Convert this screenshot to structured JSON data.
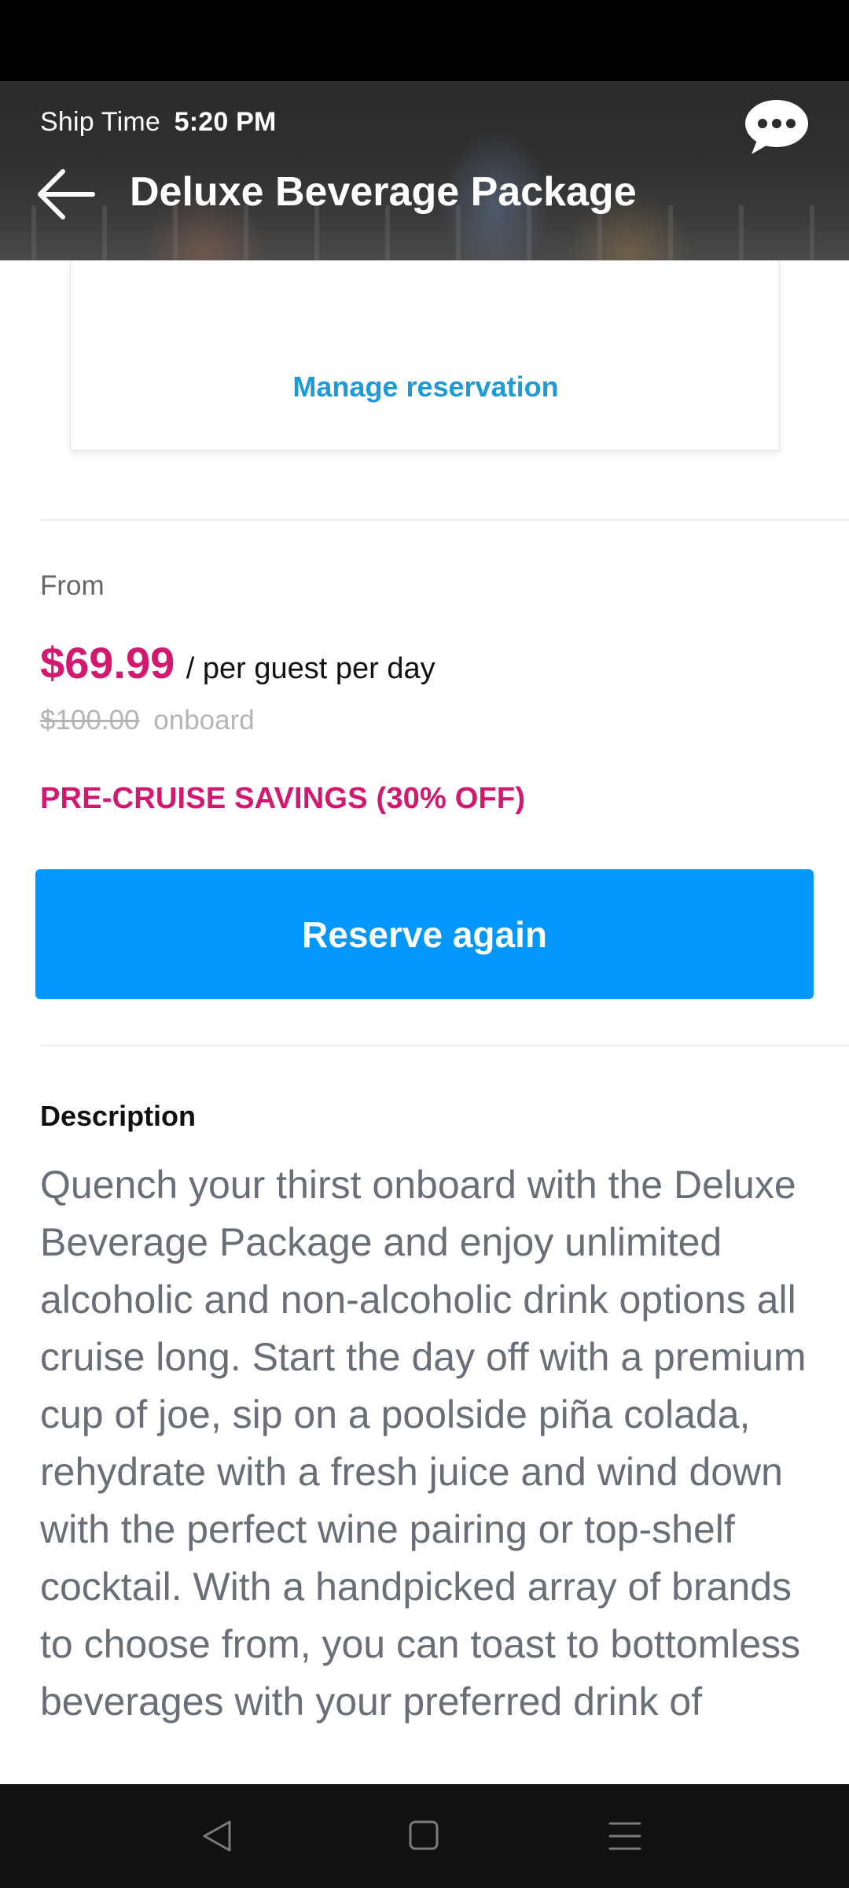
{
  "header": {
    "ship_time_label": "Ship Time",
    "ship_time_value": "5:20 PM",
    "title": "Deluxe Beverage Package",
    "back_icon": "arrow-left-icon",
    "chat_icon": "chat-bubble-icon"
  },
  "reservation_card": {
    "manage_link": "Manage reservation"
  },
  "pricing": {
    "from_label": "From",
    "price": "$69.99",
    "per_guest": "/ per guest per day",
    "old_price": "$100.00",
    "onboard_label": "onboard",
    "savings": "PRE-CRUISE SAVINGS (30% OFF)"
  },
  "actions": {
    "reserve_again": "Reserve again"
  },
  "description": {
    "heading": "Description",
    "text": "Quench your thirst onboard with the Deluxe Beverage Package and enjoy unlimited alcoholic and non-alcoholic drink options all cruise long. Start the day off with a premium cup of joe, sip on a poolside piña colada, rehydrate with a fresh juice and wind down with the perfect wine pairing or top-shelf cocktail. With a handpicked array of brands to choose from, you can toast to bottomless beverages with your preferred drink of"
  },
  "colors": {
    "accent_pink": "#d3186f",
    "link_blue": "#1c9bd8",
    "button_blue": "#0396fb"
  },
  "nav_bar": {
    "back_icon": "nav-back-triangle-icon",
    "home_icon": "nav-home-square-icon",
    "menu_icon": "nav-menu-lines-icon"
  }
}
